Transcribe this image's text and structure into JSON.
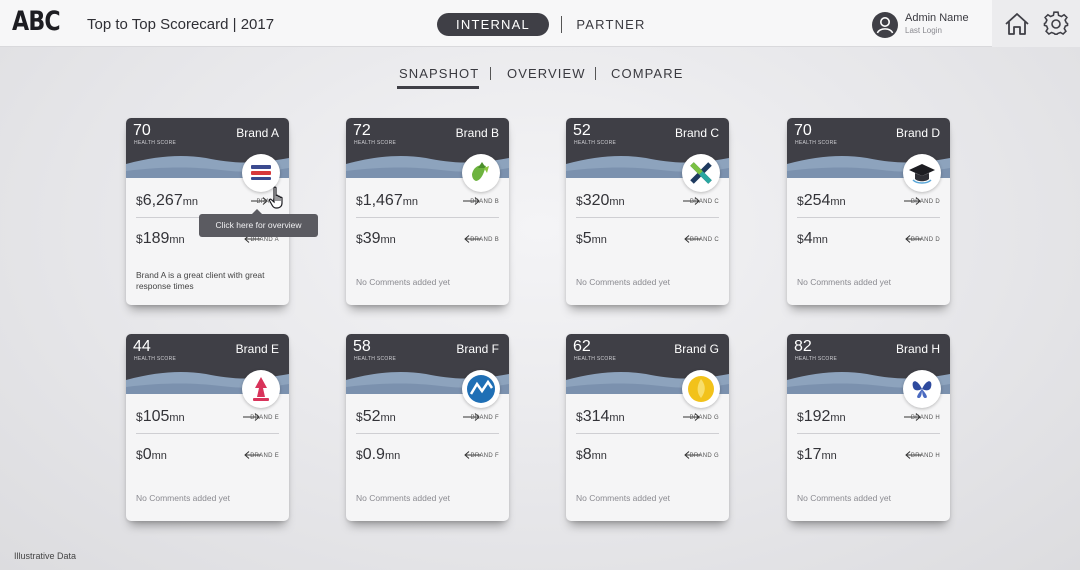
{
  "header": {
    "logo": "ABC",
    "title": "Top to Top Scorecard | 2017",
    "toggle": {
      "internal": "INTERNAL",
      "partner": "PARTNER",
      "active": "INTERNAL"
    },
    "user": {
      "name": "Admin Name",
      "sub": "Last Login"
    },
    "icons": [
      "user-icon",
      "home-icon",
      "gear-icon"
    ]
  },
  "subnav": {
    "snapshot": "SNAPSHOT",
    "overview": "OVERVIEW",
    "compare": "COMPARE",
    "active": "SNAPSHOT"
  },
  "score_label": "HEALTH SCORE",
  "currency": "$",
  "unit": "mn",
  "cards": [
    {
      "brand": "Brand A",
      "score": "70",
      "out_value": "6,267",
      "in_value": "189",
      "out_target": "BRAND",
      "in_target": "BRAND A",
      "comment": "Brand A is a great client with great response times",
      "logo_icon": "stacked-bars-logo"
    },
    {
      "brand": "Brand B",
      "score": "72",
      "out_value": "1,467",
      "in_value": "39",
      "out_target": "BRAND B",
      "in_target": "BRAND B",
      "comment": "No Comments added yet",
      "logo_icon": "green-leaf-logo"
    },
    {
      "brand": "Brand C",
      "score": "52",
      "out_value": "320",
      "in_value": "5",
      "out_target": "BRAND C",
      "in_target": "BRAND C",
      "comment": "No Comments added yet",
      "logo_icon": "x-mark-logo"
    },
    {
      "brand": "Brand D",
      "score": "70",
      "out_value": "254",
      "in_value": "4",
      "out_target": "BRAND D",
      "in_target": "BRAND D",
      "comment": "No Comments added yet",
      "logo_icon": "graduation-cap-logo"
    },
    {
      "brand": "Brand E",
      "score": "44",
      "out_value": "105",
      "in_value": "0",
      "out_target": "BRAND E",
      "in_target": "BRAND E",
      "comment": "No Comments added yet",
      "logo_icon": "red-figure-logo"
    },
    {
      "brand": "Brand F",
      "score": "58",
      "out_value": "52",
      "in_value": "0.9",
      "out_target": "BRAND F",
      "in_target": "BRAND F",
      "comment": "No Comments added yet",
      "logo_icon": "blue-chart-logo"
    },
    {
      "brand": "Brand G",
      "score": "62",
      "out_value": "314",
      "in_value": "8",
      "out_target": "BRAND G",
      "in_target": "BRAND G",
      "comment": "No Comments added yet",
      "logo_icon": "yellow-flame-logo"
    },
    {
      "brand": "Brand H",
      "score": "82",
      "out_value": "192",
      "in_value": "17",
      "out_target": "BRAND H",
      "in_target": "BRAND H",
      "comment": "No Comments added yet",
      "logo_icon": "butterfly-logo"
    }
  ],
  "tooltip": "Click here for overview",
  "footnote": "Illustrative Data",
  "colors": {
    "header_dark": "#3f3f46",
    "wave": "#8da3bd",
    "accent_active": "#3f3f46"
  }
}
